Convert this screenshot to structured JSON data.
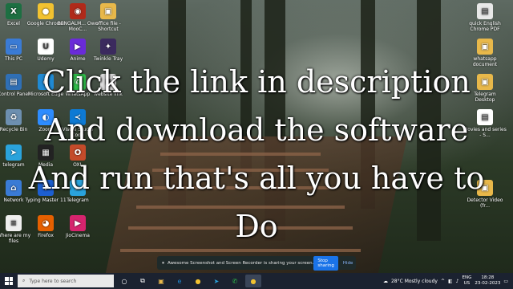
{
  "overlay": {
    "lines": [
      "Click the link in description",
      "And download the software",
      "And run that's all you have to",
      "Do"
    ]
  },
  "desktop_icons": [
    {
      "label": "Excel",
      "icon": "excel-icon",
      "color": "#1d6f42",
      "symbol": "X"
    },
    {
      "label": "Google Chrome",
      "icon": "chrome-icon",
      "color": "#f2c230",
      "symbol": "●"
    },
    {
      "label": "BENGALM... Own MooC...",
      "icon": "bengal-app-icon",
      "color": "#b02a1a",
      "symbol": "◉"
    },
    {
      "label": "office file - Shortcut",
      "icon": "folder-shortcut-icon",
      "color": "#e8b84a",
      "symbol": "▣"
    },
    {
      "label": "This PC",
      "icon": "this-pc-icon",
      "color": "#3a7bd5",
      "symbol": "▭"
    },
    {
      "label": "Udemy",
      "icon": "udemy-icon",
      "color": "#ffffff",
      "symbol": "U"
    },
    {
      "label": "Anime",
      "icon": "anime-icon",
      "color": "#6a2bd8",
      "symbol": "▶"
    },
    {
      "label": "Twinkle Tray",
      "icon": "twinkle-tray-icon",
      "color": "#3b2a5e",
      "symbol": "✦"
    },
    {
      "label": "Control Panel",
      "icon": "control-panel-icon",
      "color": "#2f6fb5",
      "symbol": "▤"
    },
    {
      "label": "Microsoft Edge",
      "icon": "edge-icon",
      "color": "#1f8ad4",
      "symbol": "e"
    },
    {
      "label": "WhatsApp",
      "icon": "whatsapp-icon",
      "color": "#2fbf4a",
      "symbol": "✆"
    },
    {
      "label": "website link",
      "icon": "text-file-icon",
      "color": "#dcdcdc",
      "symbol": "≡"
    },
    {
      "label": "Recycle Bin",
      "icon": "recycle-bin-icon",
      "color": "#6d8fb0",
      "symbol": "♻"
    },
    {
      "label": "Zoom",
      "icon": "zoom-icon",
      "color": "#2d8cff",
      "symbol": "◐"
    },
    {
      "label": "Visual Studio Code",
      "icon": "vscode-icon",
      "color": "#0e7ad4",
      "symbol": "≺"
    },
    {
      "label": "telegram",
      "icon": "telegram-folder-icon",
      "color": "#2aa3dc",
      "symbol": "➤"
    },
    {
      "label": "Media",
      "icon": "media-icon",
      "color": "#222222",
      "symbol": "▦"
    },
    {
      "label": "OXL",
      "icon": "oxl-icon",
      "color": "#c44b2a",
      "symbol": "O"
    },
    {
      "label": "Network",
      "icon": "network-icon",
      "color": "#3a7bd5",
      "symbol": "⌂"
    },
    {
      "label": "Typing Master 11",
      "icon": "typing-master-icon",
      "color": "#1d5fd0",
      "symbol": "T"
    },
    {
      "label": "Telegram",
      "icon": "telegram-icon",
      "color": "#2aa3dc",
      "symbol": "➤"
    },
    {
      "label": "Where are my files",
      "icon": "document-icon",
      "color": "#eeeeee",
      "symbol": "≡"
    },
    {
      "label": "Firefox",
      "icon": "firefox-icon",
      "color": "#e66000",
      "symbol": "◕"
    },
    {
      "label": "JioCinema",
      "icon": "jiocinema-icon",
      "color": "#d6246e",
      "symbol": "▶"
    },
    {
      "label": "quick English Chrome PDF",
      "icon": "chrome-pdf-icon",
      "color": "#e8e8e8",
      "symbol": "▤"
    },
    {
      "label": "whatsapp document",
      "icon": "folder-icon",
      "color": "#e8b84a",
      "symbol": "▣"
    },
    {
      "label": "Telegram Desktop",
      "icon": "folder-icon",
      "color": "#e8b84a",
      "symbol": "▣"
    },
    {
      "label": "Movies and series - S...",
      "icon": "pdf-file-icon",
      "color": "#ffffff",
      "symbol": "▤"
    },
    {
      "label": "Detector Video (fr...",
      "icon": "folder-icon",
      "color": "#e8b84a",
      "symbol": "▣"
    }
  ],
  "share_bar": {
    "message": "Awesome Screenshot and Screen Recorder is sharing your screen.",
    "stop_label": "Stop sharing",
    "hide_label": "Hide"
  },
  "taskbar": {
    "search_placeholder": "Type here to search",
    "weather": "28°C  Mostly cloudy",
    "language": "ENG",
    "region": "US",
    "time": "18:28",
    "date": "23-02-2023"
  }
}
